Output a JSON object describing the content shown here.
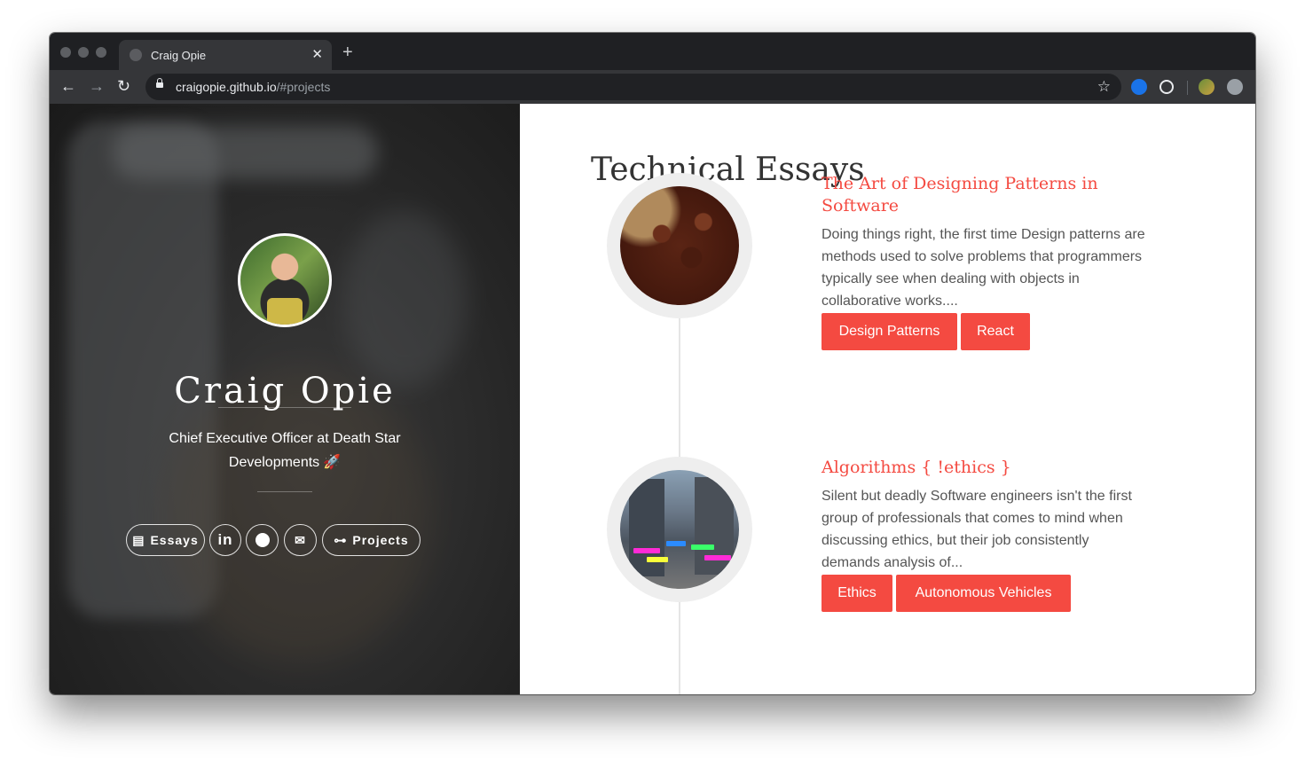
{
  "browser": {
    "tab_title": "Craig Opie",
    "url_host": "craigopie.github.io",
    "url_path": "/#projects"
  },
  "profile": {
    "name": "Craig Opie",
    "role": "Chief Executive Officer at Death Star Developments",
    "links": [
      {
        "label": "Essays",
        "icon": "document-icon"
      },
      {
        "label": "",
        "icon": "linkedin-icon"
      },
      {
        "label": "",
        "icon": "github-icon"
      },
      {
        "label": "",
        "icon": "envelope-icon"
      },
      {
        "label": "Projects",
        "icon": "sitemap-icon"
      }
    ]
  },
  "main": {
    "heading": "Technical Essays",
    "essays": [
      {
        "title": "The Art of Designing Patterns in Software",
        "excerpt": "Doing things right, the first time Design patterns are methods used to solve problems that programmers typically see when dealing with objects in collaborative works....",
        "tags": [
          "Design Patterns",
          "React"
        ]
      },
      {
        "title": "Algorithms { !ethics }",
        "excerpt": "Silent but deadly Software engineers isn't the first group of professionals that comes to mind when discussing ethics, but their job consistently demands analysis of...",
        "tags": [
          "Ethics",
          "Autonomous Vehicles"
        ]
      }
    ]
  },
  "colors": {
    "accent": "#f44a41",
    "sidebar_bg": "#262626"
  }
}
